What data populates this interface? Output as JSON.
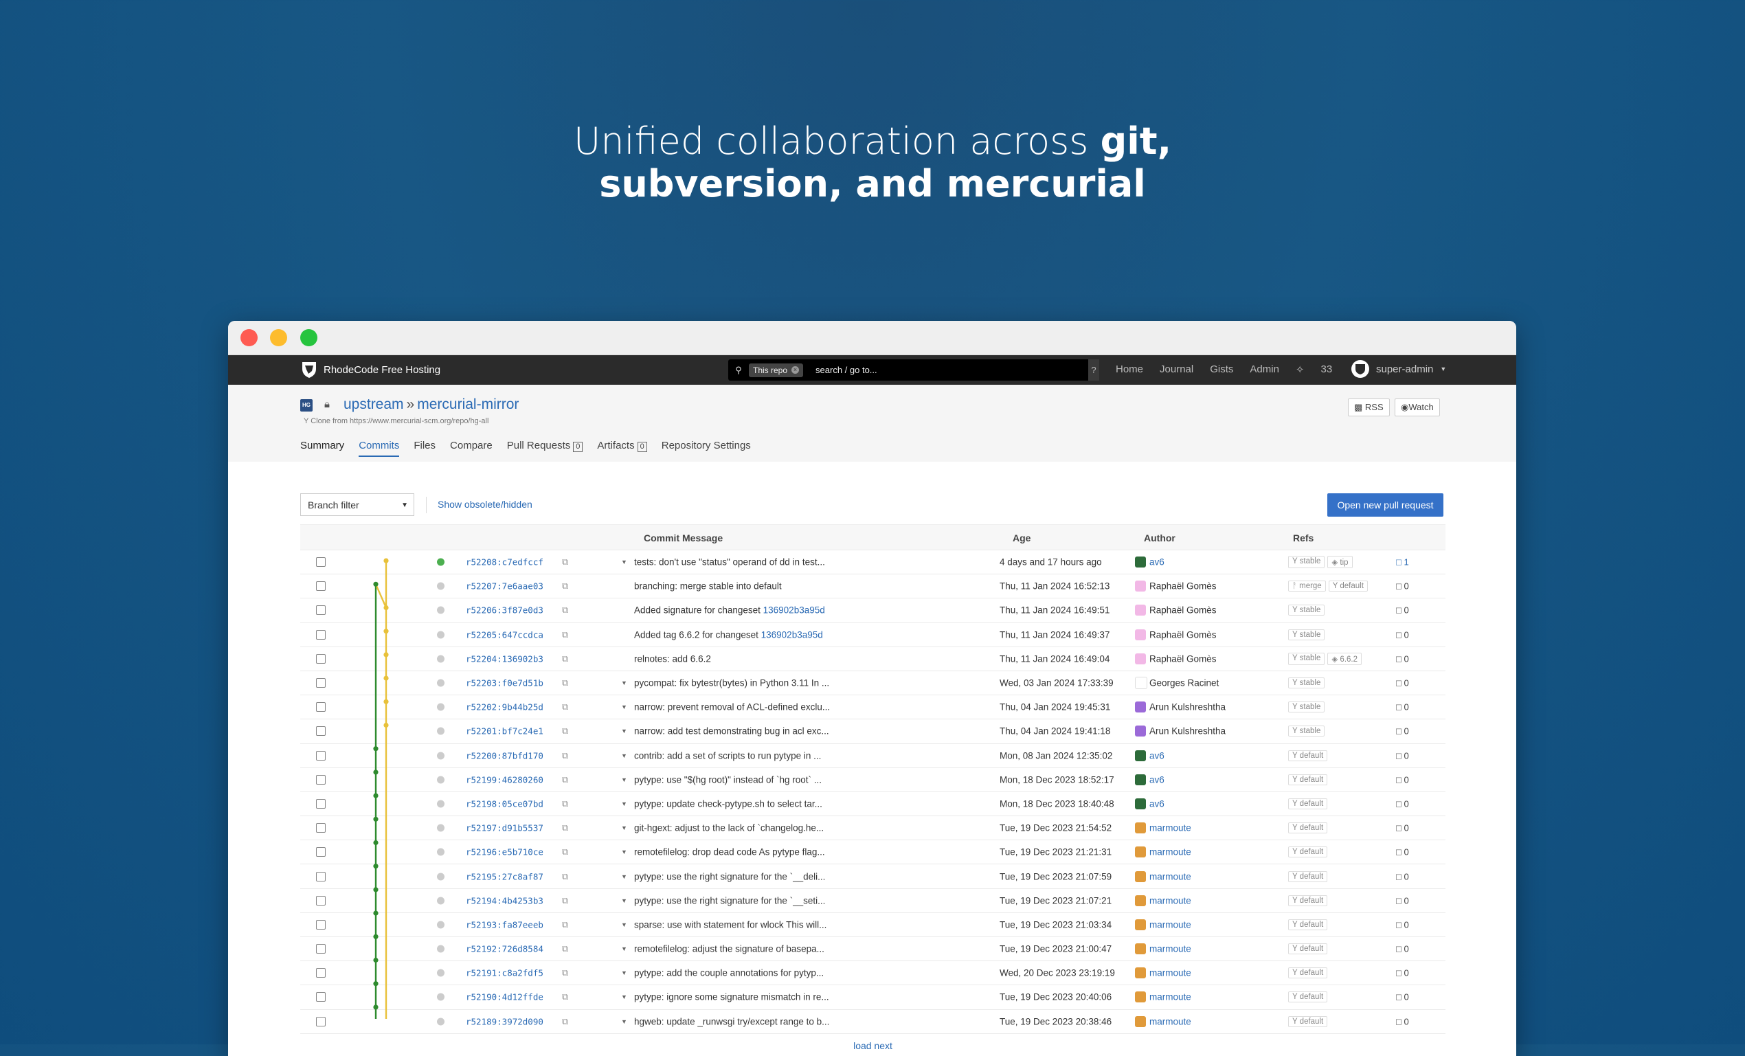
{
  "headline": {
    "line1_prefix": "Unified collaboration across ",
    "line1_bold": "git,",
    "line2_bold": "subversion, and mercurial"
  },
  "nav": {
    "brand": "RhodeCode Free Hosting",
    "search_scope": "This repo",
    "search_placeholder": "search / go to...",
    "search_help": "?",
    "links": [
      "Home",
      "Journal",
      "Gists",
      "Admin"
    ],
    "notification_count": "33",
    "user": "super-admin"
  },
  "repo": {
    "type_badge": "HG",
    "owner": "upstream",
    "separator": "»",
    "name": "mercurial-mirror",
    "clone_from": "Clone from https://www.mercurial-scm.org/repo/hg-all",
    "rss": "RSS",
    "watch": "Watch"
  },
  "tabs": [
    {
      "label": "Summary"
    },
    {
      "label": "Commits"
    },
    {
      "label": "Files"
    },
    {
      "label": "Compare"
    },
    {
      "label": "Pull Requests",
      "count": "0"
    },
    {
      "label": "Artifacts",
      "count": "0"
    },
    {
      "label": "Repository Settings"
    }
  ],
  "toolbar": {
    "branch_filter": "Branch filter",
    "show_obsolete": "Show obsolete/hidden",
    "open_pr": "Open new pull request"
  },
  "columns": {
    "message": "Commit Message",
    "age": "Age",
    "author": "Author",
    "refs": "Refs"
  },
  "commits": [
    {
      "hash": "r52208:c7edfccf",
      "msg": "tests: don't use \"status\" operand of dd in test...",
      "age": "4 days and 17 hours ago",
      "author": "av6",
      "refs": [
        "stable",
        "tip"
      ],
      "comments": "1"
    },
    {
      "hash": "r52207:7e6aae03",
      "msg": "branching: merge stable into default",
      "age": "Thu, 11 Jan 2024 16:52:13",
      "author": "Raphaël Gomès",
      "refs": [
        "merge",
        "default"
      ],
      "comments": "0"
    },
    {
      "hash": "r52206:3f87e0d3",
      "msg": "Added signature for changeset ",
      "link": "136902b3a95d",
      "age": "Thu, 11 Jan 2024 16:49:51",
      "author": "Raphaël Gomès",
      "refs": [
        "stable"
      ],
      "comments": "0"
    },
    {
      "hash": "r52205:647ccdca",
      "msg": "Added tag 6.6.2 for changeset ",
      "link": "136902b3a95d",
      "age": "Thu, 11 Jan 2024 16:49:37",
      "author": "Raphaël Gomès",
      "refs": [
        "stable"
      ],
      "comments": "0"
    },
    {
      "hash": "r52204:136902b3",
      "msg": "relnotes: add 6.6.2",
      "age": "Thu, 11 Jan 2024 16:49:04",
      "author": "Raphaël Gomès",
      "refs": [
        "stable",
        "6.6.2"
      ],
      "comments": "0"
    },
    {
      "hash": "r52203:f0e7d51b",
      "msg": "pycompat: fix bytestr(bytes) in Python 3.11 In ...",
      "age": "Wed, 03 Jan 2024 17:33:39",
      "author": "Georges Racinet",
      "refs": [
        "stable"
      ],
      "comments": "0"
    },
    {
      "hash": "r52202:9b44b25d",
      "msg": "narrow: prevent removal of ACL-defined exclu...",
      "age": "Thu, 04 Jan 2024 19:45:31",
      "author": "Arun Kulshreshtha",
      "refs": [
        "stable"
      ],
      "comments": "0"
    },
    {
      "hash": "r52201:bf7c24e1",
      "msg": "narrow: add test demonstrating bug in acl exc...",
      "age": "Thu, 04 Jan 2024 19:41:18",
      "author": "Arun Kulshreshtha",
      "refs": [
        "stable"
      ],
      "comments": "0"
    },
    {
      "hash": "r52200:87bfd170",
      "msg": "contrib: add a set of scripts to run pytype in ...",
      "age": "Mon, 08 Jan 2024 12:35:02",
      "author": "av6",
      "refs": [
        "default"
      ],
      "comments": "0"
    },
    {
      "hash": "r52199:46280260",
      "msg": "pytype: use \"$(hg root)\" instead of `hg root` ...",
      "age": "Mon, 18 Dec 2023 18:52:17",
      "author": "av6",
      "refs": [
        "default"
      ],
      "comments": "0"
    },
    {
      "hash": "r52198:05ce07bd",
      "msg": "pytype: update check-pytype.sh to select tar...",
      "age": "Mon, 18 Dec 2023 18:40:48",
      "author": "av6",
      "refs": [
        "default"
      ],
      "comments": "0"
    },
    {
      "hash": "r52197:d91b5537",
      "msg": "git-hgext: adjust to the lack of `changelog.he...",
      "age": "Tue, 19 Dec 2023 21:54:52",
      "author": "marmoute",
      "refs": [
        "default"
      ],
      "comments": "0"
    },
    {
      "hash": "r52196:e5b710ce",
      "msg": "remotefilelog: drop dead code As pytype flag...",
      "age": "Tue, 19 Dec 2023 21:21:31",
      "author": "marmoute",
      "refs": [
        "default"
      ],
      "comments": "0"
    },
    {
      "hash": "r52195:27c8af87",
      "msg": "pytype: use the right signature for the `__deli...",
      "age": "Tue, 19 Dec 2023 21:07:59",
      "author": "marmoute",
      "refs": [
        "default"
      ],
      "comments": "0"
    },
    {
      "hash": "r52194:4b4253b3",
      "msg": "pytype: use the right signature for the `__seti...",
      "age": "Tue, 19 Dec 2023 21:07:21",
      "author": "marmoute",
      "refs": [
        "default"
      ],
      "comments": "0"
    },
    {
      "hash": "r52193:fa87eeeb",
      "msg": "sparse: use with statement for wlock This will...",
      "age": "Tue, 19 Dec 2023 21:03:34",
      "author": "marmoute",
      "refs": [
        "default"
      ],
      "comments": "0"
    },
    {
      "hash": "r52192:726d8584",
      "msg": "remotefilelog: adjust the signature of basepa...",
      "age": "Tue, 19 Dec 2023 21:00:47",
      "author": "marmoute",
      "refs": [
        "default"
      ],
      "comments": "0"
    },
    {
      "hash": "r52191:c8a2fdf5",
      "msg": "pytype: add the couple annotations for pytyp...",
      "age": "Wed, 20 Dec 2023 23:19:19",
      "author": "marmoute",
      "refs": [
        "default"
      ],
      "comments": "0"
    },
    {
      "hash": "r52190:4d12ffde",
      "msg": "pytype: ignore some signature mismatch in re...",
      "age": "Tue, 19 Dec 2023 20:40:06",
      "author": "marmoute",
      "refs": [
        "default"
      ],
      "comments": "0"
    },
    {
      "hash": "r52189:3972d090",
      "msg": "hgweb: update _runwsgi try/except range to b...",
      "age": "Tue, 19 Dec 2023 20:38:46",
      "author": "marmoute",
      "refs": [
        "default"
      ],
      "comments": "0"
    }
  ],
  "load_next": "load next",
  "colors": {
    "accent": "#2a6ab4",
    "button": "#3571c8",
    "graph_stable": "#e8c13a",
    "graph_default": "#2e8b2e"
  }
}
